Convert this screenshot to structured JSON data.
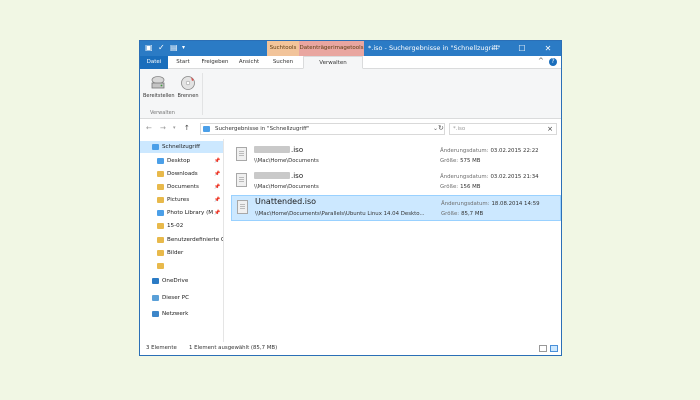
{
  "titlebar": {
    "title": "*.iso - Suchergebnisse in \"Schnellzugriff\"",
    "context_tab_1": "Suchtools",
    "context_tab_2": "Datenträgerimagetools",
    "minimize": "—",
    "maximize": "☐",
    "close": "✕"
  },
  "ribbon": {
    "tabs": [
      {
        "label": "Datei"
      },
      {
        "label": "Start"
      },
      {
        "label": "Freigeben"
      },
      {
        "label": "Ansicht"
      },
      {
        "label": "Suchen"
      },
      {
        "label": "Verwalten"
      }
    ],
    "buttons": [
      {
        "label": "Bereitstellen",
        "icon": "mount-drive-icon"
      },
      {
        "label": "Brennen",
        "icon": "burn-disc-icon"
      }
    ],
    "group_label": "Verwalten"
  },
  "address": {
    "path": "Suchergebnisse in \"Schnellzugriff\"",
    "search_value": "*.iso"
  },
  "nav": {
    "items": [
      {
        "label": "Schnellzugriff",
        "icon": "star-icon",
        "color": "#4b9fe8",
        "pinned": false,
        "selected": true,
        "indent": 0
      },
      {
        "label": "Desktop",
        "icon": "desktop-folder-icon",
        "color": "#4b9fe8",
        "pinned": true,
        "selected": false,
        "indent": 1
      },
      {
        "label": "Downloads",
        "icon": "downloads-folder-icon",
        "color": "#e8b94b",
        "pinned": true,
        "selected": false,
        "indent": 1
      },
      {
        "label": "Documents",
        "icon": "folder-icon",
        "color": "#e8b94b",
        "pinned": true,
        "selected": false,
        "indent": 1
      },
      {
        "label": "Pictures",
        "icon": "folder-icon",
        "color": "#e8b94b",
        "pinned": true,
        "selected": false,
        "indent": 1
      },
      {
        "label": "Photo Library (M",
        "icon": "photos-folder-icon",
        "color": "#4b9fe8",
        "pinned": true,
        "selected": false,
        "indent": 1
      },
      {
        "label": "15-02",
        "icon": "folder-icon",
        "color": "#e8b94b",
        "pinned": false,
        "selected": false,
        "indent": 1
      },
      {
        "label": "Benutzerdefinierte C",
        "icon": "folder-icon",
        "color": "#e8b94b",
        "pinned": false,
        "selected": false,
        "indent": 1
      },
      {
        "label": "Bilder",
        "icon": "folder-icon",
        "color": "#e8b94b",
        "pinned": false,
        "selected": false,
        "indent": 1
      },
      {
        "label": "",
        "icon": "folder-icon",
        "color": "#e8b94b",
        "pinned": false,
        "selected": false,
        "indent": 1
      },
      {
        "label": "OneDrive",
        "icon": "cloud-icon",
        "color": "#2b7bc5",
        "pinned": false,
        "selected": false,
        "indent": 0
      },
      {
        "label": "Dieser PC",
        "icon": "computer-icon",
        "color": "#5aa0d8",
        "pinned": false,
        "selected": false,
        "indent": 0
      },
      {
        "label": "Netzwerk",
        "icon": "network-icon",
        "color": "#3d86c9",
        "pinned": false,
        "selected": false,
        "indent": 0
      }
    ]
  },
  "files": [
    {
      "name": ".iso",
      "name_blurred": true,
      "path": "\\\\Mac\\Home\\Documents",
      "date_label": "Änderungsdatum:",
      "date": "03.02.2015 22:22",
      "size_label": "Größe:",
      "size": "575 MB",
      "selected": false
    },
    {
      "name": ".iso",
      "name_blurred": true,
      "path": "\\\\Mac\\Home\\Documents",
      "date_label": "Änderungsdatum:",
      "date": "03.02.2015 21:34",
      "size_label": "Größe:",
      "size": "156 MB",
      "selected": false
    },
    {
      "name": "Unattended.iso",
      "name_blurred": false,
      "path": "\\\\Mac\\Home\\Documents\\Parallels\\Ubuntu Linux 14.04 Deskto...",
      "date_label": "Änderungsdatum:",
      "date": "18.08.2014 14:59",
      "size_label": "Größe:",
      "size": "85,7 MB",
      "selected": true
    }
  ],
  "status": {
    "count": "3 Elemente",
    "selection": "1 Element ausgewählt (85,7 MB)"
  }
}
